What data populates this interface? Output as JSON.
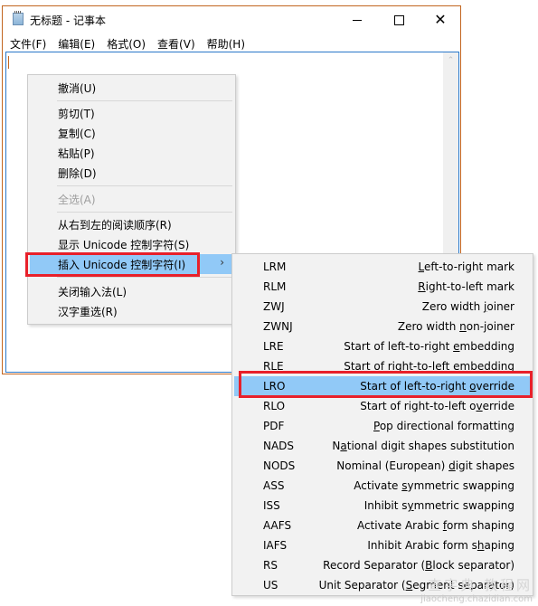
{
  "window": {
    "title": "无标题 - 记事本",
    "controls": {
      "minimize": "minimize",
      "maximize": "maximize",
      "close": "✕"
    }
  },
  "menubar": [
    {
      "label": "文件(F)"
    },
    {
      "label": "编辑(E)"
    },
    {
      "label": "格式(O)"
    },
    {
      "label": "查看(V)"
    },
    {
      "label": "帮助(H)"
    }
  ],
  "editor": {
    "text": "",
    "scroll_up_icon": "⌃"
  },
  "context_menu": {
    "items": [
      {
        "label": "撤消(U)",
        "enabled": true
      },
      {
        "label": "剪切(T)",
        "enabled": true
      },
      {
        "label": "复制(C)",
        "enabled": true
      },
      {
        "label": "粘贴(P)",
        "enabled": true
      },
      {
        "label": "删除(D)",
        "enabled": true
      },
      {
        "label": "全选(A)",
        "enabled": false
      },
      {
        "label": "从右到左的阅读顺序(R)",
        "enabled": true
      },
      {
        "label": "显示 Unicode 控制字符(S)",
        "enabled": true
      },
      {
        "label": "插入 Unicode 控制字符(I)",
        "enabled": true,
        "highlighted": true,
        "submenu_arrow": "›"
      },
      {
        "label": "关闭输入法(L)",
        "enabled": true
      },
      {
        "label": "汉字重选(R)",
        "enabled": true
      }
    ]
  },
  "submenu": {
    "items": [
      {
        "code": "LRM",
        "pre": "",
        "key": "L",
        "post": "eft-to-right mark"
      },
      {
        "code": "RLM",
        "pre": "",
        "key": "R",
        "post": "ight-to-left mark"
      },
      {
        "code": "ZWJ",
        "pre": "Zero width ",
        "key": "j",
        "post": "oiner"
      },
      {
        "code": "ZWNJ",
        "pre": "Zero width ",
        "key": "n",
        "post": "on-joiner"
      },
      {
        "code": "LRE",
        "pre": "Start of left-to-right ",
        "key": "e",
        "post": "mbedding"
      },
      {
        "code": "RLE",
        "pre": "Start of right-to-left e",
        "key": "m",
        "post": "bedding"
      },
      {
        "code": "LRO",
        "pre": "Start of left-to-right ",
        "key": "o",
        "post": "verride",
        "highlighted": true
      },
      {
        "code": "RLO",
        "pre": "Start of right-to-left o",
        "key": "v",
        "post": "erride"
      },
      {
        "code": "PDF",
        "pre": "",
        "key": "P",
        "post": "op directional formatting"
      },
      {
        "code": "NADS",
        "pre": "N",
        "key": "a",
        "post": "tional digit shapes substitution"
      },
      {
        "code": "NODS",
        "pre": "Nominal (European) ",
        "key": "d",
        "post": "igit shapes"
      },
      {
        "code": "ASS",
        "pre": "Activate ",
        "key": "s",
        "post": "ymmetric swapping"
      },
      {
        "code": "ISS",
        "pre": "Inhibit s",
        "key": "y",
        "post": "mmetric swapping"
      },
      {
        "code": "AAFS",
        "pre": "Activate Arabic ",
        "key": "f",
        "post": "orm shaping"
      },
      {
        "code": "IAFS",
        "pre": "Inhibit Arabic form s",
        "key": "h",
        "post": "aping"
      },
      {
        "code": "RS",
        "pre": "Record Separator (",
        "key": "B",
        "post": "lock separator)"
      },
      {
        "code": "US",
        "pre": "Unit Separator (",
        "key": "S",
        "post": "egment separator)"
      }
    ]
  },
  "watermark": {
    "line1": "查字典 教程网",
    "line2": "jiaocheng.chazidian.com"
  }
}
